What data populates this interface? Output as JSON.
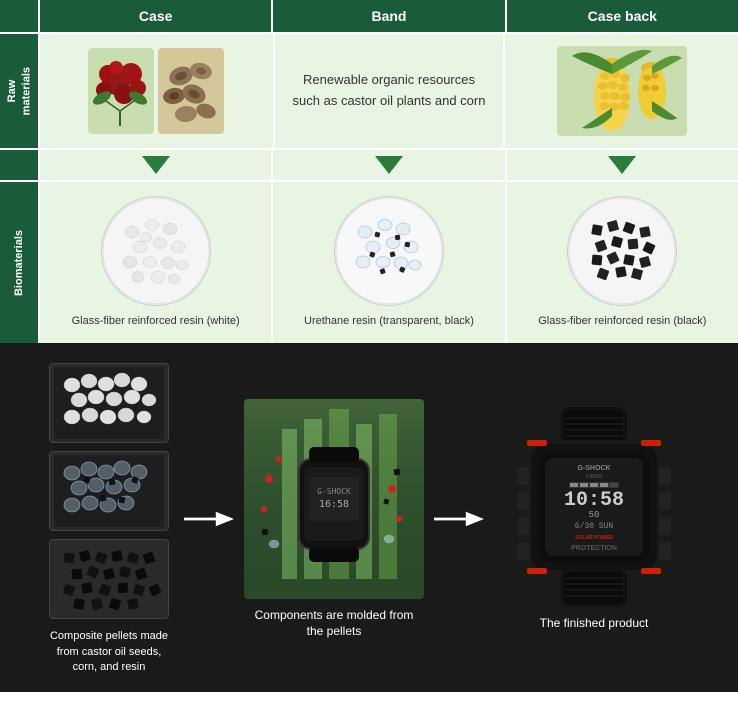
{
  "header": {
    "col1": "Case",
    "col2": "Band",
    "col3": "Case back"
  },
  "rows": {
    "raw_materials": {
      "label": "Raw\nmaterials",
      "col1_img": "plant_berries",
      "col2_text": "Renewable organic resources\nsuch as castor oil plants and corn",
      "col3_img": "corn"
    },
    "biomaterials": {
      "label": "Biomaterials",
      "col1_text": "Glass-fiber reinforced resin (white)",
      "col2_text": "Urethane resin (transparent, black)",
      "col3_text": "Glass-fiber reinforced resin (black)"
    }
  },
  "bottom": {
    "pellet_caption": "Composite pellets made from\ncastor oil seeds, corn, and resin",
    "molding_caption": "Components are\nmolded from the pellets",
    "finished_caption": "The finished product"
  }
}
